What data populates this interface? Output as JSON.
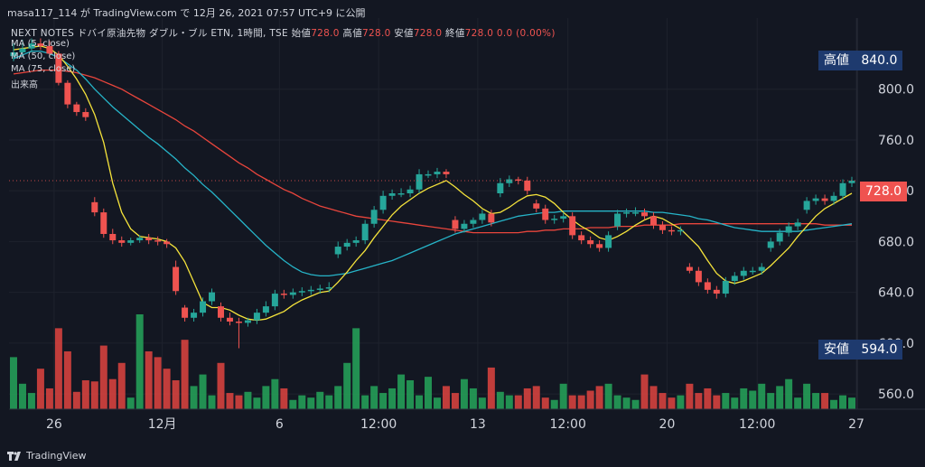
{
  "header": {
    "line1": "masa117_114 が TradingView.com で 12月 26, 2021 07:57 UTC+9 に公開"
  },
  "symbol": {
    "name": "NEXT NOTES ドバイ原油先物 ダブル・ブル ETN, 1時間, TSE",
    "open_label": "始値",
    "open_value": "728.0",
    "high_label": "高値",
    "high_value": "728.0",
    "low_label": "安値",
    "low_value": "728.0",
    "close_label": "終値",
    "close_value": "728.0",
    "change": "0.0 (0.00%)"
  },
  "legend": [
    "MA (5, close)",
    "MA (50, close)",
    "MA (75, close)",
    "出来高"
  ],
  "price_labels": {
    "high_name": "高値",
    "high_value": "840.0",
    "last_value": "728.0",
    "low_name": "安値",
    "low_value": "594.0"
  },
  "footer": {
    "brand": "TradingView"
  },
  "colors": {
    "up": "#26a69a",
    "down": "#ef5350",
    "ma5": "#f5e33b",
    "ma50": "#26b4c8",
    "ma75": "#e8453c",
    "bg": "#131722",
    "label_bg": "#1e3a6e"
  },
  "chart_data": {
    "type": "candlestick",
    "y_ticks": [
      560,
      600,
      640,
      680,
      720,
      760,
      800
    ],
    "y_tick_labels": [
      "560.0",
      "600.0",
      "640.0",
      "680.0",
      "720.0",
      "760.0",
      "800.0"
    ],
    "ylim": [
      548,
      856
    ],
    "x_ticks": [
      "26",
      "12月",
      "6",
      "12:00",
      "13",
      "12:00",
      "20",
      "12:00",
      "27"
    ],
    "x_tick_index": [
      5,
      17,
      30,
      41,
      52,
      62,
      73,
      83,
      94
    ],
    "n_bars": 94,
    "close": [
      829,
      832,
      836,
      834,
      828,
      805,
      788,
      782,
      778,
      703,
      686,
      681,
      679,
      681,
      683,
      681,
      680,
      678,
      641,
      620,
      624,
      633,
      640,
      620,
      617,
      616,
      618,
      624,
      629,
      639,
      638,
      640,
      641,
      642,
      643,
      644,
      676,
      679,
      681,
      694,
      705,
      716,
      718,
      718,
      721,
      733,
      733,
      735,
      733,
      690,
      694,
      697,
      702,
      695,
      726,
      729,
      728,
      720,
      706,
      697,
      698,
      700,
      685,
      681,
      678,
      675,
      685,
      702,
      703,
      703,
      700,
      693,
      689,
      688,
      689,
      657,
      648,
      642,
      639,
      649,
      653,
      657,
      657,
      660,
      680,
      687,
      692,
      695,
      712,
      714,
      712,
      716,
      726,
      728
    ],
    "open": [
      826,
      829,
      832,
      836,
      834,
      828,
      805,
      788,
      782,
      711,
      703,
      686,
      681,
      679,
      681,
      683,
      681,
      680,
      660,
      628,
      620,
      624,
      633,
      629,
      620,
      617,
      616,
      618,
      624,
      629,
      639,
      638,
      640,
      641,
      642,
      643,
      670,
      676,
      679,
      681,
      694,
      705,
      716,
      718,
      718,
      721,
      733,
      733,
      735,
      697,
      690,
      694,
      697,
      702,
      718,
      726,
      729,
      728,
      710,
      706,
      697,
      698,
      700,
      685,
      681,
      678,
      675,
      692,
      702,
      703,
      703,
      700,
      693,
      689,
      688,
      660,
      657,
      648,
      642,
      639,
      649,
      653,
      657,
      657,
      675,
      680,
      687,
      692,
      705,
      712,
      714,
      712,
      716,
      726
    ],
    "high": [
      836,
      839,
      840,
      840,
      838,
      830,
      807,
      790,
      785,
      715,
      706,
      690,
      684,
      683,
      685,
      686,
      684,
      682,
      665,
      630,
      627,
      636,
      643,
      632,
      624,
      620,
      620,
      627,
      633,
      642,
      642,
      643,
      644,
      645,
      646,
      648,
      680,
      682,
      684,
      697,
      708,
      720,
      721,
      722,
      724,
      737,
      736,
      738,
      737,
      700,
      697,
      699,
      705,
      705,
      730,
      732,
      731,
      731,
      713,
      709,
      701,
      703,
      703,
      688,
      684,
      681,
      688,
      705,
      706,
      707,
      706,
      703,
      696,
      692,
      692,
      663,
      660,
      651,
      645,
      652,
      656,
      660,
      660,
      663,
      683,
      690,
      695,
      698,
      715,
      717,
      717,
      719,
      729,
      731
    ],
    "low": [
      822,
      826,
      829,
      831,
      826,
      803,
      785,
      779,
      775,
      700,
      683,
      678,
      676,
      677,
      679,
      678,
      677,
      675,
      638,
      617,
      617,
      621,
      630,
      617,
      614,
      596,
      613,
      615,
      621,
      626,
      635,
      635,
      637,
      638,
      639,
      640,
      667,
      673,
      676,
      678,
      691,
      702,
      713,
      715,
      715,
      718,
      730,
      730,
      730,
      687,
      687,
      691,
      694,
      692,
      715,
      723,
      725,
      717,
      703,
      694,
      694,
      695,
      682,
      678,
      675,
      672,
      672,
      689,
      699,
      700,
      697,
      690,
      686,
      685,
      685,
      655,
      645,
      639,
      635,
      636,
      646,
      650,
      654,
      654,
      672,
      677,
      684,
      689,
      702,
      709,
      709,
      709,
      713,
      723
    ],
    "volume": [
      45,
      22,
      14,
      35,
      18,
      70,
      50,
      15,
      25,
      24,
      55,
      26,
      40,
      10,
      82,
      50,
      45,
      35,
      25,
      60,
      20,
      30,
      12,
      40,
      14,
      12,
      15,
      10,
      20,
      26,
      18,
      8,
      12,
      10,
      15,
      12,
      20,
      40,
      70,
      12,
      20,
      14,
      18,
      30,
      25,
      12,
      28,
      10,
      20,
      14,
      26,
      18,
      10,
      36,
      15,
      12,
      12,
      18,
      20,
      10,
      8,
      22,
      12,
      12,
      16,
      20,
      22,
      12,
      10,
      8,
      30,
      20,
      14,
      10,
      12,
      22,
      14,
      18,
      12,
      14,
      10,
      18,
      16,
      22,
      14,
      20,
      26,
      10,
      22,
      14,
      14,
      8,
      12,
      10
    ],
    "ma5": [
      831,
      832,
      833,
      834,
      832,
      827,
      818,
      808,
      796,
      780,
      758,
      726,
      703,
      690,
      684,
      683,
      682,
      680,
      675,
      664,
      648,
      632,
      628,
      628,
      626,
      622,
      619,
      618,
      619,
      622,
      625,
      630,
      634,
      637,
      640,
      641,
      648,
      656,
      665,
      673,
      683,
      692,
      701,
      708,
      713,
      718,
      722,
      725,
      728,
      723,
      717,
      712,
      706,
      702,
      703,
      707,
      712,
      716,
      717,
      715,
      710,
      703,
      697,
      692,
      688,
      683,
      681,
      684,
      688,
      693,
      697,
      700,
      698,
      694,
      690,
      683,
      676,
      665,
      655,
      649,
      647,
      649,
      652,
      655,
      661,
      668,
      675,
      684,
      692,
      700,
      706,
      710,
      714,
      718
    ],
    "ma50": [
      824,
      827,
      830,
      830,
      828,
      825,
      820,
      815,
      808,
      800,
      793,
      786,
      780,
      774,
      768,
      762,
      757,
      751,
      745,
      738,
      732,
      725,
      719,
      712,
      705,
      698,
      691,
      684,
      677,
      671,
      665,
      660,
      656,
      654,
      653,
      653,
      654,
      655,
      657,
      659,
      661,
      663,
      665,
      668,
      671,
      674,
      677,
      680,
      683,
      686,
      688,
      690,
      692,
      694,
      696,
      698,
      700,
      701,
      702,
      703,
      703,
      704,
      704,
      704,
      704,
      704,
      704,
      704,
      704,
      704,
      704,
      703,
      703,
      702,
      701,
      700,
      698,
      697,
      695,
      693,
      691,
      690,
      689,
      688,
      688,
      688,
      688,
      688,
      689,
      690,
      691,
      692,
      693,
      694
    ],
    "ma75": [
      812,
      813,
      814,
      815,
      815,
      815,
      814,
      813,
      811,
      809,
      806,
      803,
      800,
      796,
      792,
      788,
      784,
      780,
      776,
      771,
      767,
      762,
      757,
      752,
      747,
      742,
      738,
      733,
      729,
      725,
      721,
      718,
      714,
      711,
      708,
      706,
      704,
      702,
      700,
      699,
      698,
      697,
      696,
      695,
      694,
      693,
      692,
      691,
      690,
      689,
      688,
      687,
      687,
      687,
      687,
      687,
      687,
      688,
      688,
      689,
      689,
      690,
      690,
      690,
      691,
      691,
      691,
      692,
      692,
      692,
      693,
      693,
      693,
      693,
      694,
      694,
      694,
      694,
      694,
      694,
      694,
      694,
      694,
      694,
      694,
      694,
      694,
      694,
      694,
      694,
      693,
      693,
      693,
      693
    ]
  }
}
